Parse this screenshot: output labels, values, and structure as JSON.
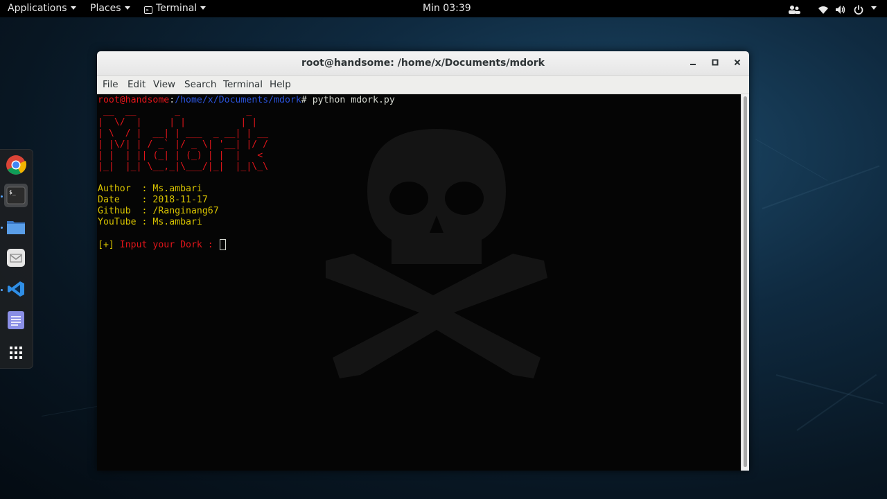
{
  "topbar": {
    "applications": "Applications",
    "places": "Places",
    "terminal": "Terminal",
    "clock": "Min 03:39"
  },
  "dock": {
    "items": [
      "chrome-icon",
      "terminal-icon",
      "files-icon",
      "mail-icon",
      "vscode-icon",
      "text-editor-icon",
      "show-apps-icon"
    ]
  },
  "window": {
    "title": "root@handsome: /home/x/Documents/mdork",
    "menu": [
      "File",
      "Edit",
      "View",
      "Search",
      "Terminal",
      "Help"
    ]
  },
  "terminal": {
    "prompt_user": "root@handsome",
    "prompt_sep": ":",
    "prompt_path": "/home/x/Documents/mdork",
    "prompt_hash": "# ",
    "command": "python mdork.py",
    "banner": [
      " __  __       _            _",
      "|  \\/  |     | |          | |",
      "| \\  / |  __| | ___  _ __| | __",
      "| |\\/| | / _` |/ _ \\| '__| |/ /",
      "| |  | || (_| | (_) | |  |   <",
      "|_|  |_| \\__,_|\\___/|_|  |_|\\_\\"
    ],
    "info": [
      {
        "key": "Author  : ",
        "value": "Ms.ambari"
      },
      {
        "key": "Date    : ",
        "value": "2018-11-17"
      },
      {
        "key": "Github  : ",
        "value": "/Ranginang67"
      },
      {
        "key": "YouTube : ",
        "value": "Ms.ambari"
      }
    ],
    "input_bracket": "[+]",
    "input_prompt": " Input your Dork : "
  },
  "colors": {
    "prompt_user": "#e2151a",
    "prompt_path": "#2a52d8",
    "banner": "#e2151a",
    "info_text": "#d8c300"
  }
}
